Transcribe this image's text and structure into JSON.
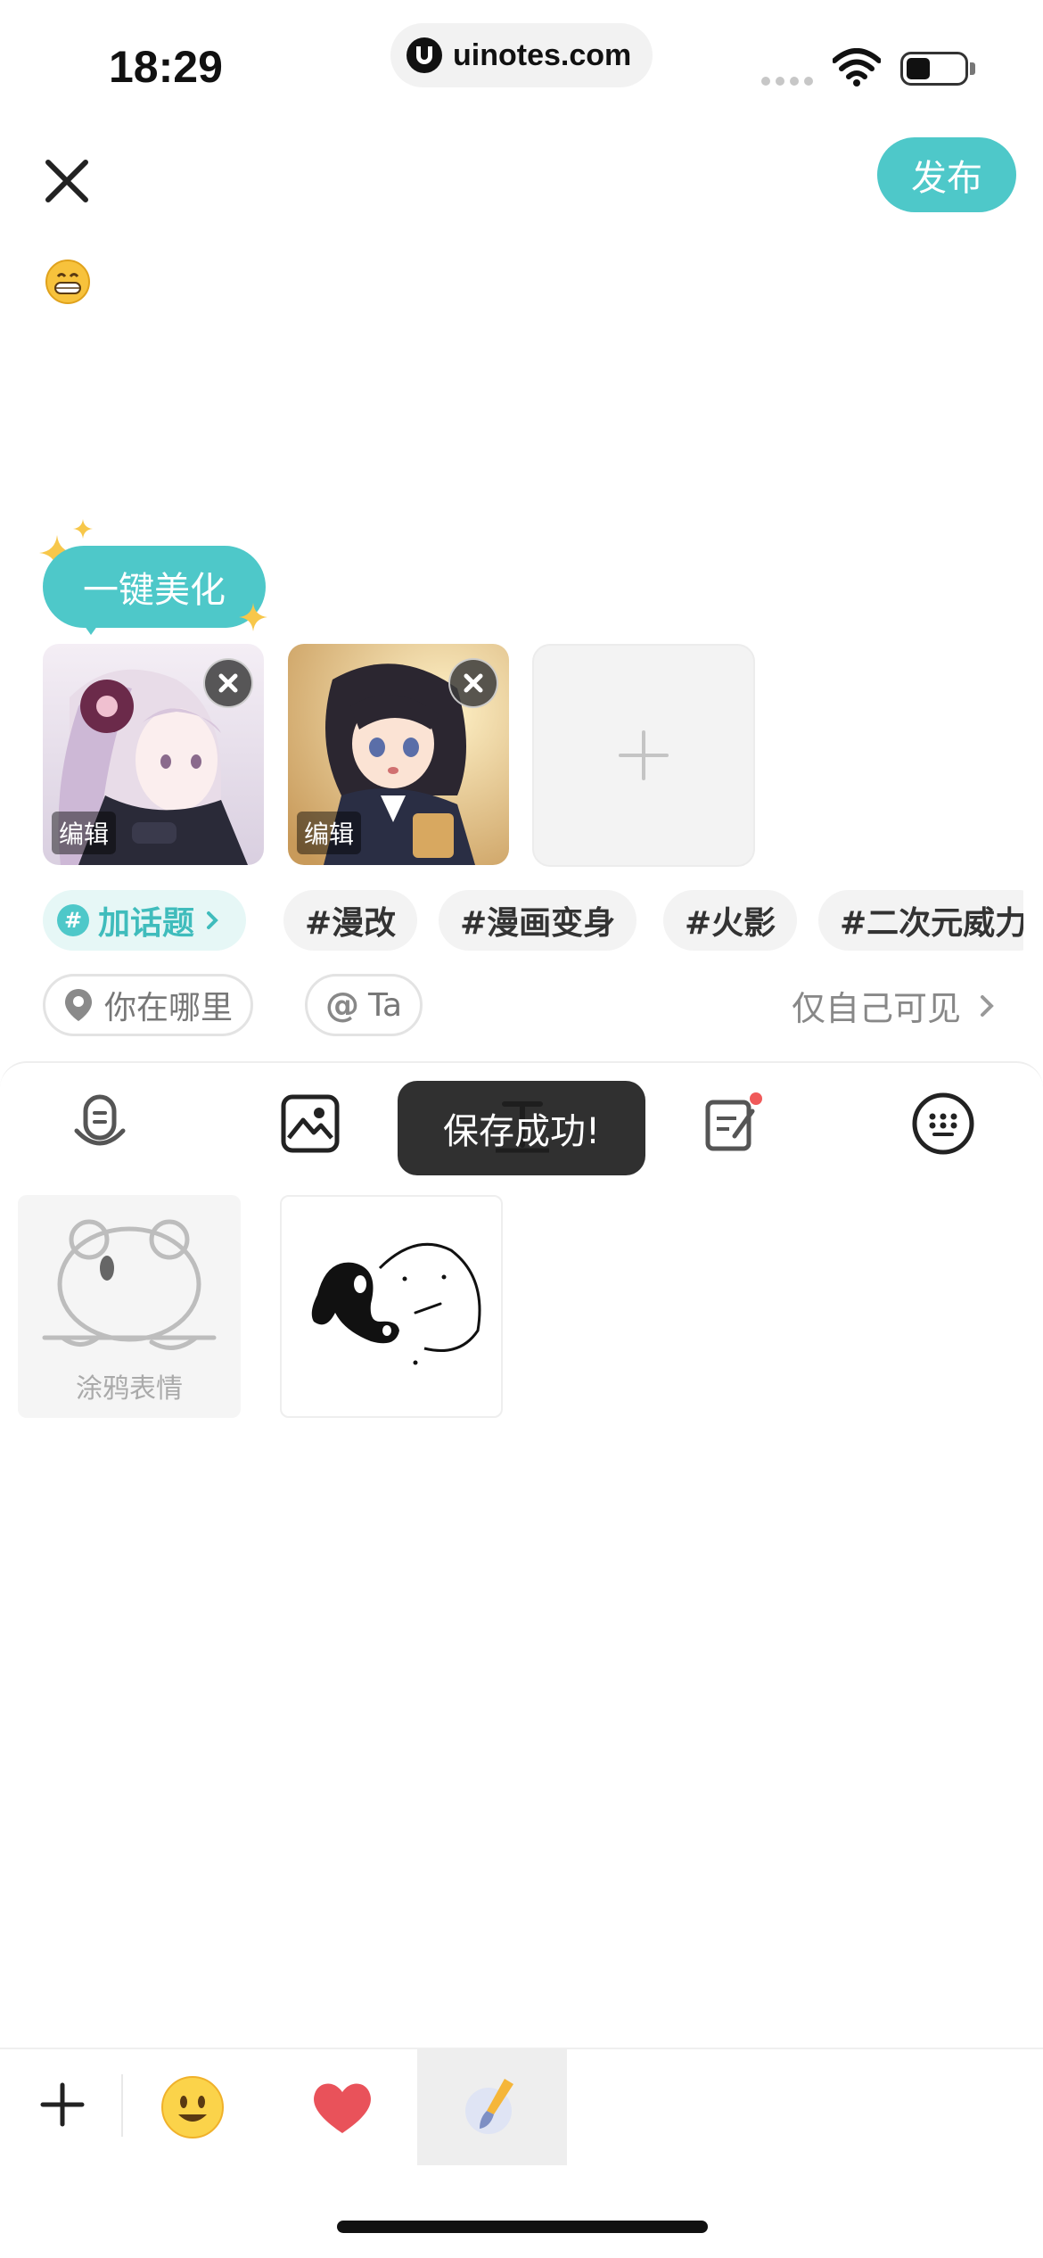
{
  "status_bar": {
    "time": "18:29",
    "url": "uinotes.com"
  },
  "header": {
    "close_icon": "close-icon",
    "publish_label": "发布",
    "accent": "#4ec8c9"
  },
  "post": {
    "emoji": "grinning-face"
  },
  "beautify": {
    "label": "一键美化"
  },
  "images": [
    {
      "edit_label": "编辑"
    },
    {
      "edit_label": "编辑"
    }
  ],
  "topics": {
    "add_label": "加话题",
    "tags": [
      "#漫改",
      "#漫画变身",
      "#火影",
      "#二次元威力"
    ]
  },
  "location": {
    "placeholder": "你在哪里",
    "mention": "Ta",
    "visibility": "仅自己可见"
  },
  "toolbar": {
    "icons": [
      "voice-icon",
      "image-icon",
      "text-icon",
      "note-edit-icon",
      "keyboard-icon"
    ]
  },
  "toast": {
    "message": "保存成功!"
  },
  "stickers": {
    "doodle_label": "涂鸦表情"
  },
  "bottom_tabs": {
    "icons": [
      "add-icon",
      "emoji-icon",
      "heart-icon",
      "brush-icon"
    ],
    "active": "brush-icon"
  }
}
